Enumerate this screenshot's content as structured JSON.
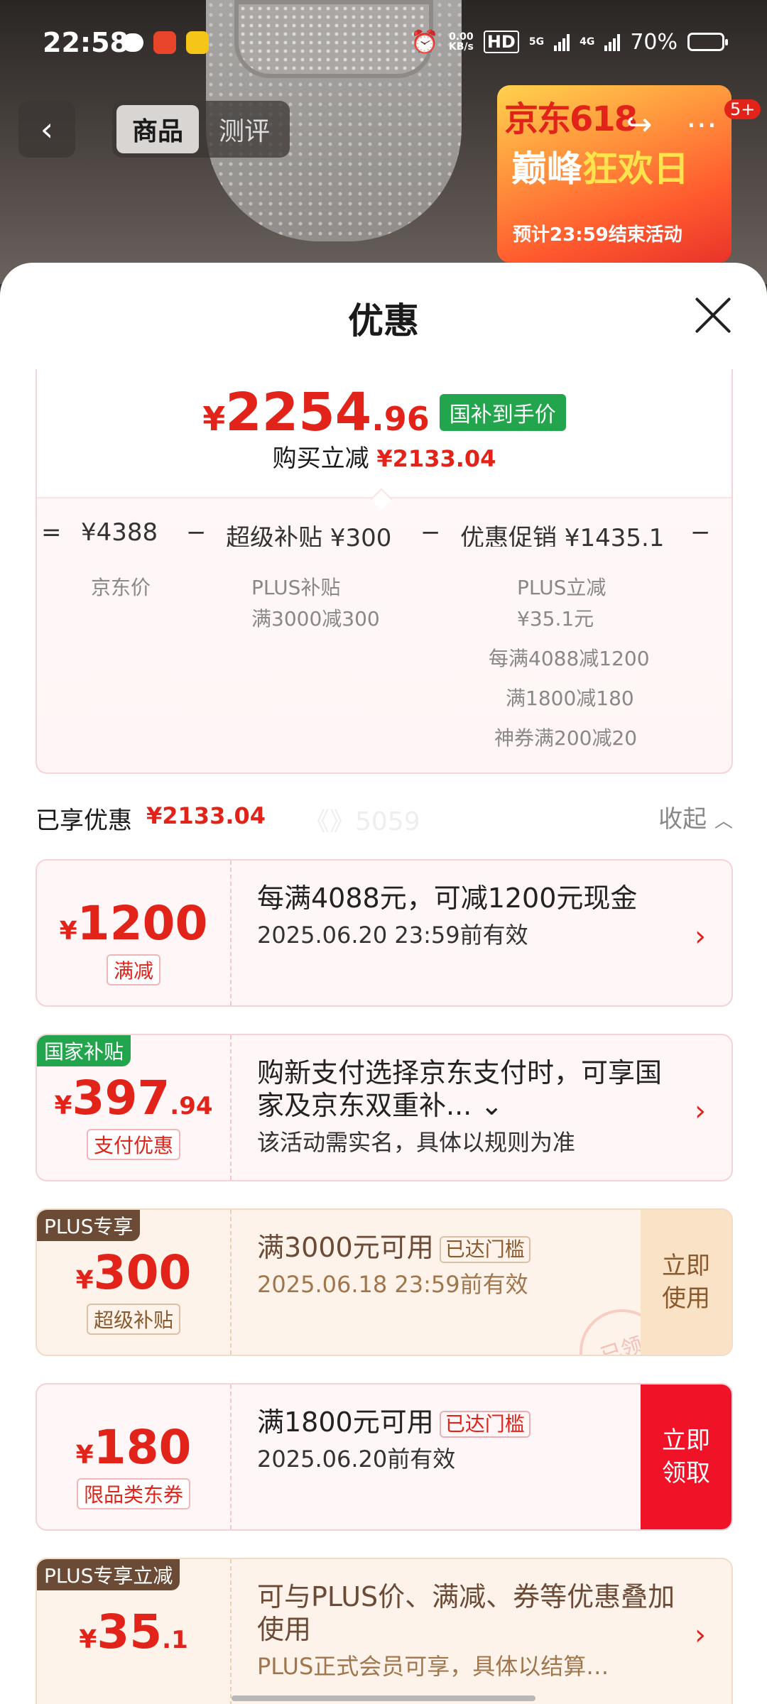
{
  "status_bar": {
    "time": "22:58",
    "net_speed": "0.00",
    "net_unit": "KB/s",
    "hd": "HD",
    "net1": "5G",
    "net2": "4G",
    "battery_text": "70%",
    "battery_level": 0.7
  },
  "nav": {
    "tab_product": "商品",
    "tab_review": "测评",
    "badge": "5+"
  },
  "promo": {
    "logo": "京东618",
    "day_a": "巅峰",
    "day_b": "狂欢日",
    "end_text": "预计23:59结束活动"
  },
  "sheet": {
    "title": "优惠"
  },
  "final": {
    "currency": "¥",
    "price_int": "2254",
    "price_dec": ".96",
    "tag": "国补到手价",
    "reduce_label": "购买立减",
    "reduce_value": "¥2133.04"
  },
  "formula": {
    "eq": "=",
    "jd_price": "¥4388",
    "minus": "−",
    "super_subsidy": "超级补贴 ¥300",
    "promo": "优惠促销 ¥1435.1",
    "jd_price_label": "京东价",
    "plus_subsidy_a": "PLUS补贴",
    "plus_subsidy_b": "满3000减300",
    "promo_items": [
      "PLUS立减",
      "¥35.1元",
      "每满4088减1200",
      "满1800减180",
      "神券满200减20"
    ]
  },
  "summary": {
    "label": "已享优惠",
    "value": "¥2133.04",
    "watermark": "《》5059",
    "collapse": "收起"
  },
  "coupons": [
    {
      "currency": "¥",
      "amount_int": "1200",
      "amount_dec": "",
      "tag": "满减",
      "title": "每满4088元，可减1200元现金",
      "sub": "2025.06.20 23:59前有效"
    },
    {
      "corner": "国家补贴",
      "currency": "¥",
      "amount_int": "397",
      "amount_dec": ".94",
      "tag": "支付优惠",
      "title": "购新支付选择京东支付时，可享国家及京东双重补... ⌄",
      "sub": "该活动需实名，具体以规则为准"
    },
    {
      "corner": "PLUS专享",
      "currency": "¥",
      "amount_int": "300",
      "amount_dec": "",
      "tag": "超级补贴",
      "title": "满3000元可用",
      "met": "已达门槛",
      "sub": "2025.06.18 23:59前有效",
      "action": "立即使用",
      "stamp": "已领"
    },
    {
      "currency": "¥",
      "amount_int": "180",
      "amount_dec": "",
      "tag": "限品类东券",
      "title": "满1800元可用",
      "met": "已达门槛",
      "sub": "2025.06.20前有效",
      "action": "立即领取"
    },
    {
      "corner": "PLUS专享立减",
      "currency": "¥",
      "amount_int": "35",
      "amount_dec": ".1",
      "tag": "",
      "title": "可与PLUS价、满减、券等优惠叠加使用",
      "sub": "PLUS正式会员可享，具体以结算…"
    }
  ],
  "colors": {
    "accent_red": "#e2231a",
    "gov_green": "#23a54d",
    "plus_brown": "#6b4a36"
  }
}
